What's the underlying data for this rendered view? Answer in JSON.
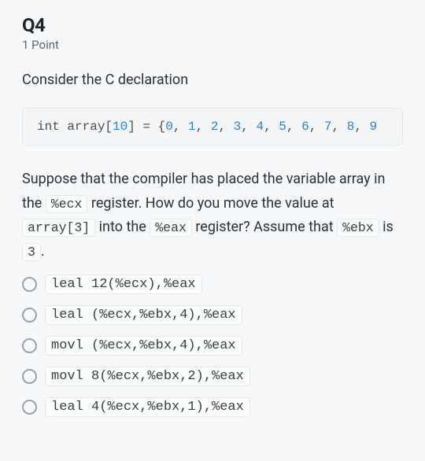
{
  "question": {
    "id_label": "Q4",
    "points_label": "1 Point",
    "prompt_intro": "Consider the C declaration",
    "code_prefix": "int array[",
    "code_size": "10",
    "code_mid": "] = {",
    "code_values": [
      "0",
      "1",
      "2",
      "3",
      "4",
      "5",
      "6",
      "7",
      "8",
      "9"
    ],
    "body_parts": {
      "p1": "Suppose that the compiler has placed the variable array in the ",
      "reg1": "%ecx",
      "p2": " register. How do you move the value at ",
      "arr": "array[3]",
      "p3": " into the ",
      "reg2": "%eax",
      "p4": " register? Assume that ",
      "reg3": "%ebx",
      "p5": " is ",
      "val3": "3",
      "p6": "."
    },
    "options": [
      "leal 12(%ecx),%eax",
      "leal (%ecx,%ebx,4),%eax",
      "movl (%ecx,%ebx,4),%eax",
      "movl 8(%ecx,%ebx,2),%eax",
      "leal 4(%ecx,%ebx,1),%eax"
    ]
  }
}
